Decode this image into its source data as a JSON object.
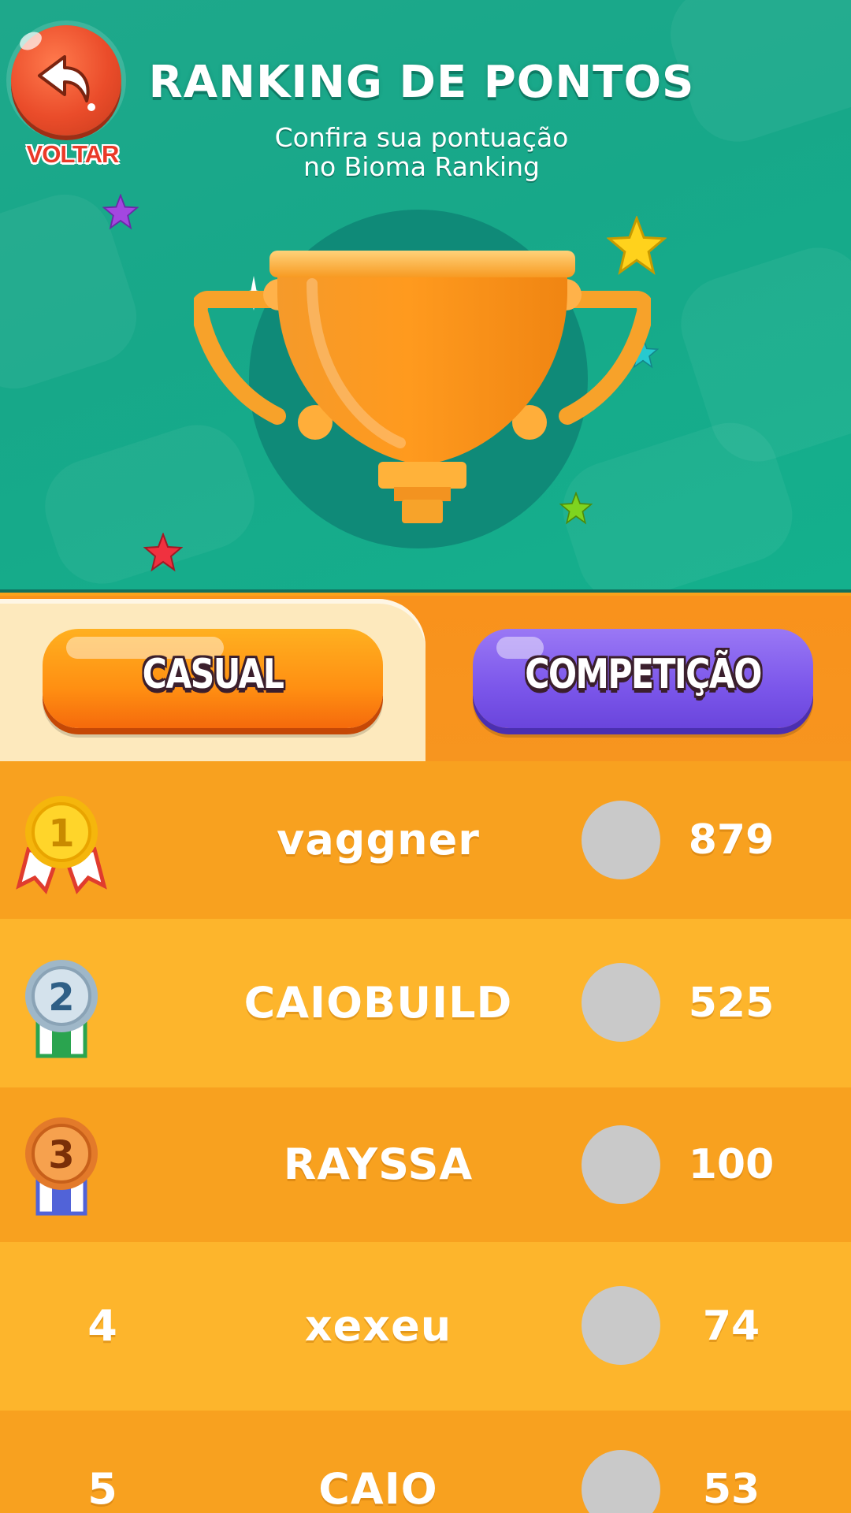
{
  "colors": {
    "header_bg": "#17a889",
    "accent_orange": "#f9a21b",
    "casual_tab": "#ff8f12",
    "competicao_tab": "#7b56ea",
    "back_button": "#ea4c2a"
  },
  "header": {
    "back_button": {
      "icon": "back-arrow-icon",
      "label": "VOLTAR"
    },
    "title": "RANKING DE PONTOS",
    "subtitle_line1": "Confira sua pontuação",
    "subtitle_line2": "no Bioma Ranking",
    "trophy_icon": "trophy-icon"
  },
  "tabs": [
    {
      "label": "CASUAL",
      "active": true
    },
    {
      "label": "COMPETIÇÃO",
      "active": false
    }
  ],
  "ranking": [
    {
      "position": "1",
      "medal": "gold-medal-icon",
      "name": "vaggner",
      "score": "879"
    },
    {
      "position": "2",
      "medal": "silver-medal-icon",
      "name": "CAIOBUILD",
      "score": "525"
    },
    {
      "position": "3",
      "medal": "bronze-medal-icon",
      "name": "RAYSSA",
      "score": "100"
    },
    {
      "position": "4",
      "medal": null,
      "name": "xexeu",
      "score": "74"
    },
    {
      "position": "5",
      "medal": null,
      "name": "CAIO",
      "score": "53"
    }
  ]
}
